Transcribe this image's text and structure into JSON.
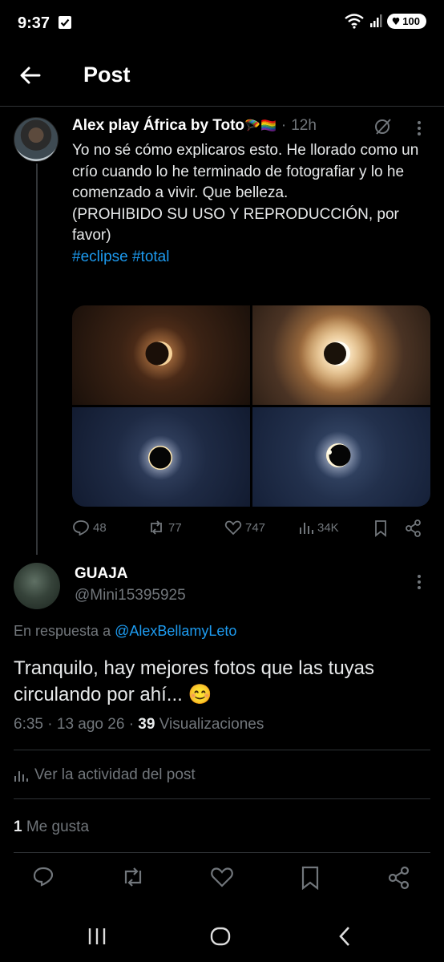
{
  "status_bar": {
    "time": "9:37",
    "battery": "100",
    "network": "6"
  },
  "header": {
    "title": "Post"
  },
  "post": {
    "author_name": "Alex play África by Toto",
    "author_emojis": "🪂🏳️‍🌈",
    "dot": "·",
    "time": "12h",
    "text_lines": [
      "Yo no sé cómo explicaros esto. He llorado como un crío cuando lo he terminado de fotografiar y lo he comenzado a vivir. Que belleza.",
      "(PROHIBIDO SU USO Y REPRODUCCIÓN, por favor)"
    ],
    "hashtags": "#eclipse #total",
    "replies": "48",
    "reposts": "77",
    "likes": "747",
    "views": "34K"
  },
  "reply": {
    "name": "GUAJA",
    "handle": "@Mini15395925",
    "in_reply_prefix": "En respuesta a",
    "in_reply_user": "@AlexBellamyLeto",
    "text": "Tranquilo, hay mejores fotos que las tuyas circulando por ahí... 😊",
    "time": "6:35",
    "date": "13 ago 26",
    "sep": "·",
    "views_count": "39",
    "views_label": "Visualizaciones",
    "activity_label": "Ver la actividad del post",
    "likes_count": "1",
    "likes_label": "Me gusta"
  },
  "colors": {
    "background": "#000000",
    "text": "#e7e9ea",
    "secondary": "#71767b",
    "link": "#1d9bf0",
    "divider": "#2f3336"
  }
}
